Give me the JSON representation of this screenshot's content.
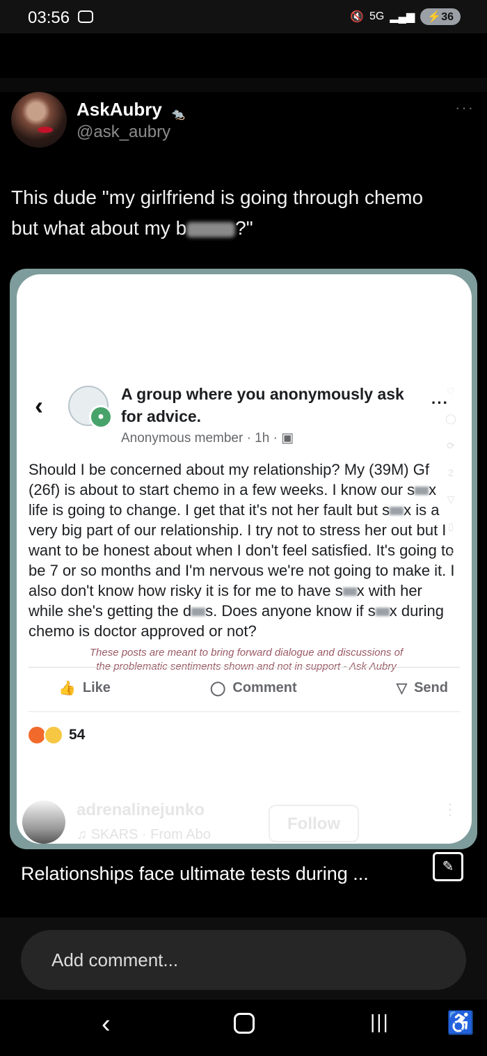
{
  "status_bar": {
    "time": "03:56",
    "network": "5G",
    "battery": "36",
    "icons": [
      "screenshot-icon",
      "mute-icon",
      "signal-icon",
      "battery-icon"
    ]
  },
  "tweet": {
    "display_name": "AskAubry",
    "handle": "@ask_aubry",
    "more": "···",
    "text_line1": "This dude \"my girlfriend is going through chemo",
    "text_line2_start": "but what about my b",
    "text_line2_end": "?\""
  },
  "post": {
    "group_name": "A group where you anonymously ask for advice.",
    "meta": "Anonymous member · 1h · ",
    "more": "···",
    "body_parts": [
      "Should I be concerned about my relationship? My (39M) Gf (26f) is about to start chemo in a few weeks. I know our s",
      "x life is going to change. I get that it's not her fault but s",
      "x is a very big part of our relationship. I try not to stress her out but I want to be honest about when I don't feel satisfied. It's going to be 7 or so months and I'm nervous we're not going to make it. I also don't know how risky it is for me to have s",
      "x with her while she's getting the d",
      "s. Does anyone know if s",
      "x during chemo is doctor approved or not?"
    ],
    "disclaimer_line1": "These posts are meant to bring forward dialogue and discussions of",
    "disclaimer_line2": "the problematic sentiments shown and not in support - Ask Aubry",
    "actions": {
      "like": "Like",
      "comment": "Comment",
      "send": "Send"
    },
    "reaction_count": "54"
  },
  "reel_overlay": {
    "username": "adrenalinejunko",
    "music": "SKARS · From Abo",
    "follow": "Follow",
    "side_counts": [
      "",
      "",
      "",
      "2",
      "",
      "5"
    ]
  },
  "caption": "Relationships face ultimate tests during ...",
  "comment_placeholder": "Add comment..."
}
